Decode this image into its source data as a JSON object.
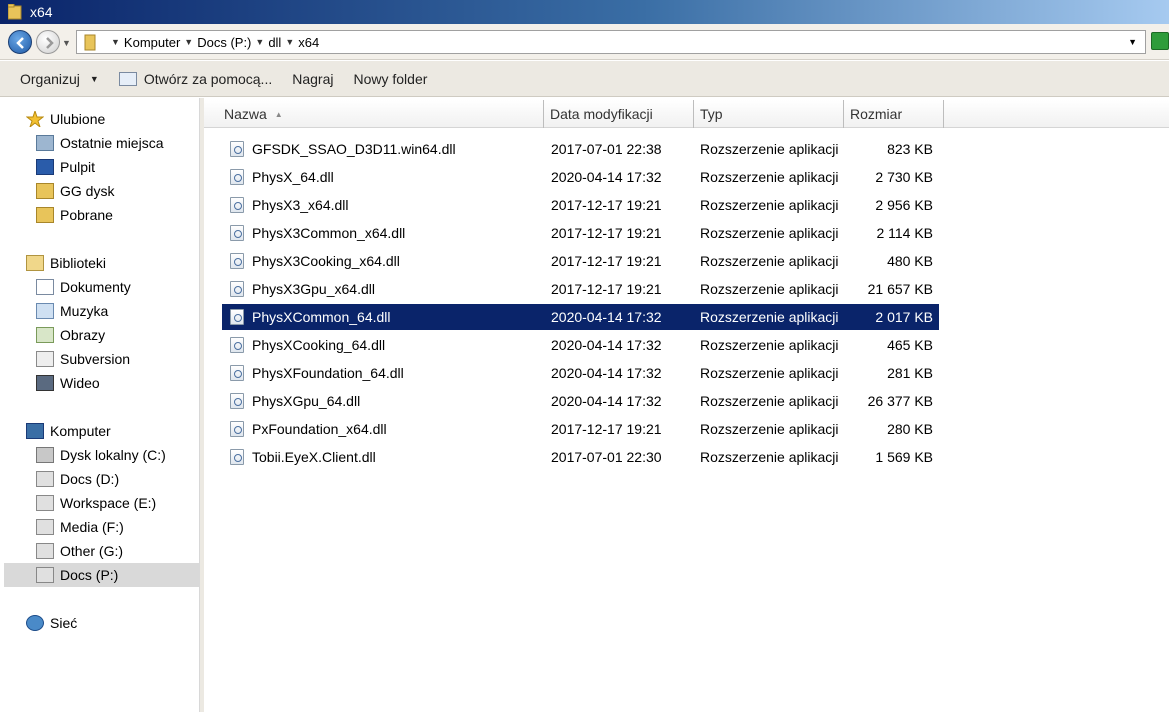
{
  "window": {
    "title": "x64"
  },
  "address": {
    "crumbs": [
      "Komputer",
      "Docs (P:)",
      "dll",
      "x64"
    ]
  },
  "toolbar": {
    "organize": "Organizuj",
    "open_with": "Otwórz za pomocą...",
    "burn": "Nagraj",
    "new_folder": "Nowy folder"
  },
  "nav": {
    "favorites": "Ulubione",
    "recent": "Ostatnie miejsca",
    "desktop": "Pulpit",
    "gg": "GG dysk",
    "downloads": "Pobrane",
    "libraries": "Biblioteki",
    "documents": "Dokumenty",
    "music": "Muzyka",
    "pictures": "Obrazy",
    "subversion": "Subversion",
    "video": "Wideo",
    "computer": "Komputer",
    "drive_c": "Dysk lokalny (C:)",
    "drive_d": "Docs (D:)",
    "drive_e": "Workspace (E:)",
    "drive_f": "Media (F:)",
    "drive_g": "Other (G:)",
    "drive_p": "Docs (P:)",
    "network": "Sieć"
  },
  "columns": {
    "name": "Nazwa",
    "date": "Data modyfikacji",
    "type": "Typ",
    "size": "Rozmiar"
  },
  "files": [
    {
      "name": "GFSDK_SSAO_D3D11.win64.dll",
      "date": "2017-07-01 22:38",
      "type": "Rozszerzenie aplikacji",
      "size": "823 KB"
    },
    {
      "name": "PhysX_64.dll",
      "date": "2020-04-14 17:32",
      "type": "Rozszerzenie aplikacji",
      "size": "2 730 KB"
    },
    {
      "name": "PhysX3_x64.dll",
      "date": "2017-12-17 19:21",
      "type": "Rozszerzenie aplikacji",
      "size": "2 956 KB"
    },
    {
      "name": "PhysX3Common_x64.dll",
      "date": "2017-12-17 19:21",
      "type": "Rozszerzenie aplikacji",
      "size": "2 114 KB"
    },
    {
      "name": "PhysX3Cooking_x64.dll",
      "date": "2017-12-17 19:21",
      "type": "Rozszerzenie aplikacji",
      "size": "480 KB"
    },
    {
      "name": "PhysX3Gpu_x64.dll",
      "date": "2017-12-17 19:21",
      "type": "Rozszerzenie aplikacji",
      "size": "21 657 KB"
    },
    {
      "name": "PhysXCommon_64.dll",
      "date": "2020-04-14 17:32",
      "type": "Rozszerzenie aplikacji",
      "size": "2 017 KB"
    },
    {
      "name": "PhysXCooking_64.dll",
      "date": "2020-04-14 17:32",
      "type": "Rozszerzenie aplikacji",
      "size": "465 KB"
    },
    {
      "name": "PhysXFoundation_64.dll",
      "date": "2020-04-14 17:32",
      "type": "Rozszerzenie aplikacji",
      "size": "281 KB"
    },
    {
      "name": "PhysXGpu_64.dll",
      "date": "2020-04-14 17:32",
      "type": "Rozszerzenie aplikacji",
      "size": "26 377 KB"
    },
    {
      "name": "PxFoundation_x64.dll",
      "date": "2017-12-17 19:21",
      "type": "Rozszerzenie aplikacji",
      "size": "280 KB"
    },
    {
      "name": "Tobii.EyeX.Client.dll",
      "date": "2017-07-01 22:30",
      "type": "Rozszerzenie aplikacji",
      "size": "1 569 KB"
    }
  ],
  "colors": {
    "selection": "#0a246a",
    "titlebar_start": "#0a246a",
    "titlebar_end": "#a6caf0"
  }
}
